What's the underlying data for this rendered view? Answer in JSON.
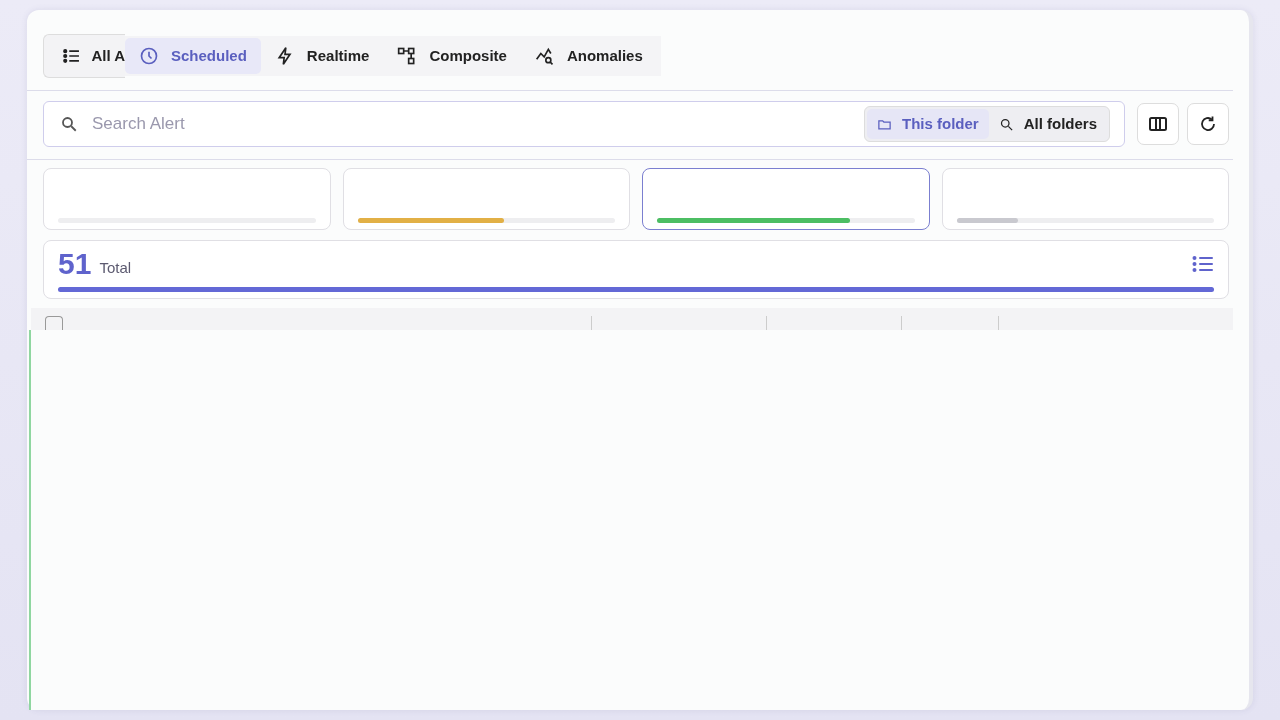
{
  "tabs": [
    {
      "label": "All A",
      "selected": false
    },
    {
      "label": "Scheduled",
      "selected": true
    },
    {
      "label": "Realtime",
      "selected": false
    },
    {
      "label": "Composite",
      "selected": false
    },
    {
      "label": "Anomalies",
      "selected": false
    }
  ],
  "search": {
    "placeholder": "Search Alert"
  },
  "scope": [
    {
      "label": "This folder",
      "selected": true
    },
    {
      "label": "All folders",
      "selected": false
    }
  ],
  "stat_cards": [
    {
      "selected": false
    },
    {
      "level": 0.57,
      "color": "#e2b046",
      "selected": false
    },
    {
      "level": 0.75,
      "color": "#4cbe63",
      "selected": true
    },
    {
      "level": 0.24,
      "color": "#c9c9cf",
      "selected": false
    }
  ],
  "total": {
    "value": "51",
    "label": "Total",
    "level": 1
  },
  "table": {
    "select_all": {
      "checked": false
    }
  }
}
